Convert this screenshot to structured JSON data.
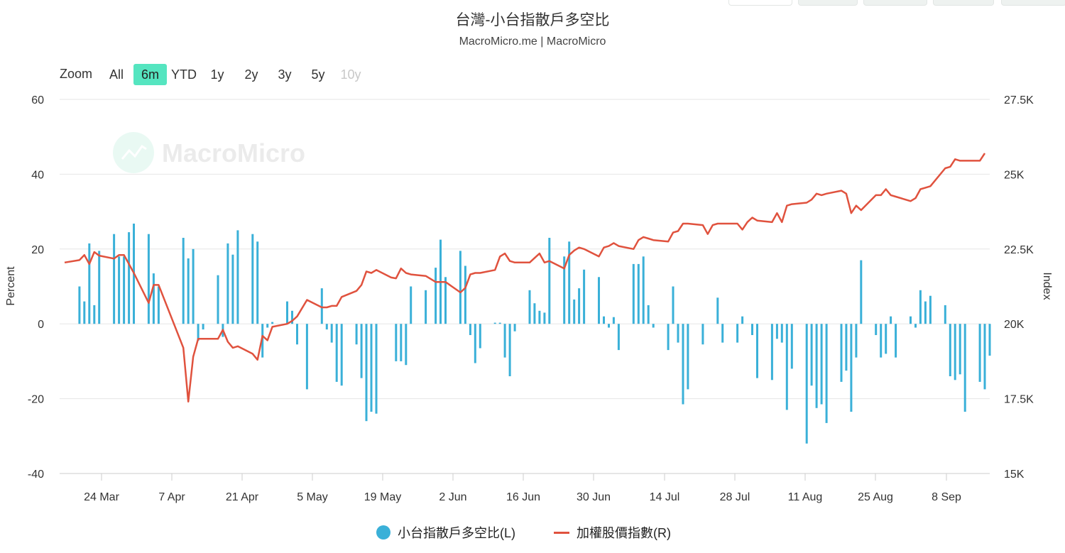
{
  "title": "台灣-小台指散戶多空比",
  "subtitle": "MacroMicro.me | MacroMicro",
  "watermark": "MacroMicro",
  "zoom": {
    "label": "Zoom",
    "buttons": [
      {
        "label": "All",
        "state": "normal"
      },
      {
        "label": "6m",
        "state": "active"
      },
      {
        "label": "YTD",
        "state": "normal"
      },
      {
        "label": "1y",
        "state": "normal"
      },
      {
        "label": "2y",
        "state": "normal"
      },
      {
        "label": "3y",
        "state": "normal"
      },
      {
        "label": "5y",
        "state": "normal"
      },
      {
        "label": "10y",
        "state": "disabled"
      }
    ]
  },
  "legend": {
    "bar_label": "小台指散戶多空比(L)",
    "line_label": "加權股價指數(R)"
  },
  "colors": {
    "bar": "#3ab0d8",
    "line": "#e0523e",
    "active_zoom": "#55e5c0",
    "grid": "#e6e6e6"
  },
  "chart_data": {
    "type": "bar+line",
    "x_ticks": [
      "24 Mar",
      "7 Apr",
      "21 Apr",
      "5 May",
      "19 May",
      "2 Jun",
      "16 Jun",
      "30 Jun",
      "14 Jul",
      "28 Jul",
      "11 Aug",
      "25 Aug",
      "8 Sep"
    ],
    "y_left": {
      "label": "Percent",
      "ticks": [
        "60",
        "40",
        "20",
        "0",
        "-20",
        "-40"
      ],
      "range": [
        -40,
        60
      ]
    },
    "y_right": {
      "label": "Index",
      "ticks": [
        "27.5K",
        "25K",
        "22.5K",
        "20K",
        "17.5K",
        "15K"
      ],
      "range": [
        15000,
        27500
      ]
    },
    "series": [
      {
        "name": "小台指散戶多空比(L)",
        "kind": "bar",
        "axis": "left",
        "points": [
          [
            "2025-03-17",
            10
          ],
          [
            "2025-03-18",
            6
          ],
          [
            "2025-03-19",
            21.5
          ],
          [
            "2025-03-20",
            5
          ],
          [
            "2025-03-21",
            19.5
          ],
          [
            "2025-03-24",
            24
          ],
          [
            "2025-03-25",
            18
          ],
          [
            "2025-03-26",
            18
          ],
          [
            "2025-03-27",
            24.5
          ],
          [
            "2025-03-28",
            26.8
          ],
          [
            "2025-03-31",
            24
          ],
          [
            "2025-04-01",
            13.5
          ],
          [
            "2025-04-02",
            10
          ],
          [
            "2025-04-07",
            23
          ],
          [
            "2025-04-08",
            17.5
          ],
          [
            "2025-04-09",
            20
          ],
          [
            "2025-04-10",
            -4.5
          ],
          [
            "2025-04-11",
            -1.5
          ],
          [
            "2025-04-14",
            13
          ],
          [
            "2025-04-15",
            -3.5
          ],
          [
            "2025-04-16",
            21.5
          ],
          [
            "2025-04-17",
            18.5
          ],
          [
            "2025-04-18",
            25
          ],
          [
            "2025-04-21",
            24
          ],
          [
            "2025-04-22",
            22
          ],
          [
            "2025-04-23",
            -9
          ],
          [
            "2025-04-24",
            -1
          ],
          [
            "2025-04-25",
            0.5
          ],
          [
            "2025-04-28",
            6
          ],
          [
            "2025-04-29",
            3.5
          ],
          [
            "2025-04-30",
            -5.5
          ],
          [
            "2025-05-02",
            -17.5
          ],
          [
            "2025-05-05",
            9.5
          ],
          [
            "2025-05-06",
            -1.5
          ],
          [
            "2025-05-07",
            -5
          ],
          [
            "2025-05-08",
            -15.5
          ],
          [
            "2025-05-09",
            -16.5
          ],
          [
            "2025-05-12",
            -5.5
          ],
          [
            "2025-05-13",
            -14.5
          ],
          [
            "2025-05-14",
            -26
          ],
          [
            "2025-05-15",
            -23.5
          ],
          [
            "2025-05-16",
            -24
          ],
          [
            "2025-05-20",
            -10
          ],
          [
            "2025-05-21",
            -10
          ],
          [
            "2025-05-22",
            -11
          ],
          [
            "2025-05-23",
            10
          ],
          [
            "2025-05-26",
            9
          ],
          [
            "2025-05-28",
            15
          ],
          [
            "2025-05-29",
            22.5
          ],
          [
            "2025-05-30",
            12.5
          ],
          [
            "2025-06-02",
            19.5
          ],
          [
            "2025-06-03",
            15.5
          ],
          [
            "2025-06-04",
            -3
          ],
          [
            "2025-06-05",
            -10.5
          ],
          [
            "2025-06-06",
            -6.5
          ],
          [
            "2025-06-09",
            0.3
          ],
          [
            "2025-06-10",
            0.3
          ],
          [
            "2025-06-11",
            -9
          ],
          [
            "2025-06-12",
            -14
          ],
          [
            "2025-06-13",
            -2
          ],
          [
            "2025-06-16",
            9
          ],
          [
            "2025-06-17",
            5.5
          ],
          [
            "2025-06-18",
            3.5
          ],
          [
            "2025-06-19",
            3
          ],
          [
            "2025-06-20",
            23
          ],
          [
            "2025-06-23",
            18
          ],
          [
            "2025-06-24",
            22
          ],
          [
            "2025-06-25",
            6.5
          ],
          [
            "2025-06-26",
            9.5
          ],
          [
            "2025-06-27",
            14.5
          ],
          [
            "2025-06-30",
            12.5
          ],
          [
            "2025-07-01",
            2
          ],
          [
            "2025-07-02",
            -1
          ],
          [
            "2025-07-03",
            1.8
          ],
          [
            "2025-07-04",
            -7
          ],
          [
            "2025-07-07",
            16
          ],
          [
            "2025-07-08",
            16
          ],
          [
            "2025-07-09",
            18
          ],
          [
            "2025-07-10",
            5
          ],
          [
            "2025-07-11",
            -1
          ],
          [
            "2025-07-14",
            -7
          ],
          [
            "2025-07-15",
            10
          ],
          [
            "2025-07-16",
            -5
          ],
          [
            "2025-07-17",
            -21.5
          ],
          [
            "2025-07-18",
            -17.5
          ],
          [
            "2025-07-21",
            -5.5
          ],
          [
            "2025-07-24",
            7
          ],
          [
            "2025-07-25",
            -5
          ],
          [
            "2025-07-28",
            -5
          ],
          [
            "2025-07-29",
            2
          ],
          [
            "2025-07-31",
            -3
          ],
          [
            "2025-08-01",
            -14.5
          ],
          [
            "2025-08-04",
            -15
          ],
          [
            "2025-08-05",
            -4
          ],
          [
            "2025-08-06",
            -5
          ],
          [
            "2025-08-07",
            -23
          ],
          [
            "2025-08-08",
            -12
          ],
          [
            "2025-08-11",
            -32
          ],
          [
            "2025-08-12",
            -16.5
          ],
          [
            "2025-08-13",
            -22.5
          ],
          [
            "2025-08-14",
            -21.5
          ],
          [
            "2025-08-15",
            -26.5
          ],
          [
            "2025-08-18",
            -15.5
          ],
          [
            "2025-08-19",
            -12.5
          ],
          [
            "2025-08-20",
            -23.5
          ],
          [
            "2025-08-21",
            -9
          ],
          [
            "2025-08-22",
            17
          ],
          [
            "2025-08-25",
            -3
          ],
          [
            "2025-08-26",
            -9
          ],
          [
            "2025-08-27",
            -8
          ],
          [
            "2025-08-28",
            2
          ],
          [
            "2025-08-29",
            -9
          ],
          [
            "2025-09-01",
            2
          ],
          [
            "2025-09-02",
            -1
          ],
          [
            "2025-09-03",
            9
          ],
          [
            "2025-09-04",
            6
          ],
          [
            "2025-09-05",
            7.5
          ],
          [
            "2025-09-08",
            5
          ],
          [
            "2025-09-09",
            -14
          ],
          [
            "2025-09-10",
            -15
          ],
          [
            "2025-09-11",
            -13.5
          ],
          [
            "2025-09-12",
            -23.5
          ],
          [
            "2025-09-15",
            -15.5
          ],
          [
            "2025-09-16",
            -17.5
          ],
          [
            "2025-09-17",
            -8.5
          ]
        ]
      },
      {
        "name": "加權股價指數(R)",
        "kind": "line",
        "axis": "right",
        "points": [
          [
            "2025-03-14",
            22050
          ],
          [
            "2025-03-17",
            22130
          ],
          [
            "2025-03-18",
            22300
          ],
          [
            "2025-03-19",
            22000
          ],
          [
            "2025-03-20",
            22400
          ],
          [
            "2025-03-21",
            22280
          ],
          [
            "2025-03-24",
            22180
          ],
          [
            "2025-03-25",
            22300
          ],
          [
            "2025-03-26",
            22300
          ],
          [
            "2025-03-27",
            22000
          ],
          [
            "2025-03-28",
            21700
          ],
          [
            "2025-03-31",
            20700
          ],
          [
            "2025-04-01",
            21300
          ],
          [
            "2025-04-02",
            21300
          ],
          [
            "2025-04-07",
            19200
          ],
          [
            "2025-04-08",
            17400
          ],
          [
            "2025-04-09",
            18900
          ],
          [
            "2025-04-10",
            19500
          ],
          [
            "2025-04-11",
            19500
          ],
          [
            "2025-04-14",
            19500
          ],
          [
            "2025-04-15",
            19800
          ],
          [
            "2025-04-16",
            19400
          ],
          [
            "2025-04-17",
            19200
          ],
          [
            "2025-04-18",
            19250
          ],
          [
            "2025-04-21",
            19000
          ],
          [
            "2025-04-22",
            18800
          ],
          [
            "2025-04-23",
            19600
          ],
          [
            "2025-04-24",
            19450
          ],
          [
            "2025-04-25",
            19900
          ],
          [
            "2025-04-28",
            20000
          ],
          [
            "2025-04-29",
            20100
          ],
          [
            "2025-04-30",
            20250
          ],
          [
            "2025-05-02",
            20800
          ],
          [
            "2025-05-05",
            20550
          ],
          [
            "2025-05-06",
            20550
          ],
          [
            "2025-05-07",
            20600
          ],
          [
            "2025-05-08",
            20600
          ],
          [
            "2025-05-09",
            20900
          ],
          [
            "2025-05-12",
            21100
          ],
          [
            "2025-05-13",
            21300
          ],
          [
            "2025-05-14",
            21750
          ],
          [
            "2025-05-15",
            21700
          ],
          [
            "2025-05-16",
            21800
          ],
          [
            "2025-05-19",
            21550
          ],
          [
            "2025-05-20",
            21520
          ],
          [
            "2025-05-21",
            21850
          ],
          [
            "2025-05-22",
            21700
          ],
          [
            "2025-05-23",
            21650
          ],
          [
            "2025-05-26",
            21600
          ],
          [
            "2025-05-28",
            21400
          ],
          [
            "2025-05-29",
            21400
          ],
          [
            "2025-05-30",
            21400
          ],
          [
            "2025-06-02",
            21050
          ],
          [
            "2025-06-03",
            21200
          ],
          [
            "2025-06-04",
            21650
          ],
          [
            "2025-06-05",
            21700
          ],
          [
            "2025-06-06",
            21700
          ],
          [
            "2025-06-09",
            21800
          ],
          [
            "2025-06-10",
            22250
          ],
          [
            "2025-06-11",
            22350
          ],
          [
            "2025-06-12",
            22100
          ],
          [
            "2025-06-13",
            22050
          ],
          [
            "2025-06-16",
            22050
          ],
          [
            "2025-06-17",
            22200
          ],
          [
            "2025-06-18",
            22350
          ],
          [
            "2025-06-19",
            22050
          ],
          [
            "2025-06-20",
            22100
          ],
          [
            "2025-06-23",
            21850
          ],
          [
            "2025-06-24",
            22300
          ],
          [
            "2025-06-25",
            22450
          ],
          [
            "2025-06-26",
            22550
          ],
          [
            "2025-06-27",
            22500
          ],
          [
            "2025-06-30",
            22250
          ],
          [
            "2025-07-01",
            22550
          ],
          [
            "2025-07-02",
            22600
          ],
          [
            "2025-07-03",
            22700
          ],
          [
            "2025-07-04",
            22600
          ],
          [
            "2025-07-07",
            22500
          ],
          [
            "2025-07-08",
            22800
          ],
          [
            "2025-07-09",
            22900
          ],
          [
            "2025-07-10",
            22850
          ],
          [
            "2025-07-11",
            22800
          ],
          [
            "2025-07-14",
            22750
          ],
          [
            "2025-07-15",
            23050
          ],
          [
            "2025-07-16",
            23100
          ],
          [
            "2025-07-17",
            23350
          ],
          [
            "2025-07-18",
            23350
          ],
          [
            "2025-07-21",
            23300
          ],
          [
            "2025-07-22",
            23000
          ],
          [
            "2025-07-23",
            23300
          ],
          [
            "2025-07-24",
            23350
          ],
          [
            "2025-07-25",
            23350
          ],
          [
            "2025-07-28",
            23350
          ],
          [
            "2025-07-29",
            23150
          ],
          [
            "2025-07-30",
            23400
          ],
          [
            "2025-07-31",
            23550
          ],
          [
            "2025-08-01",
            23450
          ],
          [
            "2025-08-04",
            23400
          ],
          [
            "2025-08-05",
            23700
          ],
          [
            "2025-08-06",
            23400
          ],
          [
            "2025-08-07",
            23950
          ],
          [
            "2025-08-08",
            24000
          ],
          [
            "2025-08-11",
            24050
          ],
          [
            "2025-08-12",
            24150
          ],
          [
            "2025-08-13",
            24350
          ],
          [
            "2025-08-14",
            24300
          ],
          [
            "2025-08-15",
            24350
          ],
          [
            "2025-08-18",
            24450
          ],
          [
            "2025-08-19",
            24350
          ],
          [
            "2025-08-20",
            23700
          ],
          [
            "2025-08-21",
            23950
          ],
          [
            "2025-08-22",
            23800
          ],
          [
            "2025-08-25",
            24300
          ],
          [
            "2025-08-26",
            24300
          ],
          [
            "2025-08-27",
            24500
          ],
          [
            "2025-08-28",
            24300
          ],
          [
            "2025-08-29",
            24250
          ],
          [
            "2025-09-01",
            24100
          ],
          [
            "2025-09-02",
            24200
          ],
          [
            "2025-09-03",
            24500
          ],
          [
            "2025-09-04",
            24550
          ],
          [
            "2025-09-05",
            24600
          ],
          [
            "2025-09-08",
            25200
          ],
          [
            "2025-09-09",
            25250
          ],
          [
            "2025-09-10",
            25500
          ],
          [
            "2025-09-11",
            25450
          ],
          [
            "2025-09-12",
            25450
          ],
          [
            "2025-09-15",
            25450
          ],
          [
            "2025-09-16",
            25700
          ]
        ]
      }
    ]
  }
}
